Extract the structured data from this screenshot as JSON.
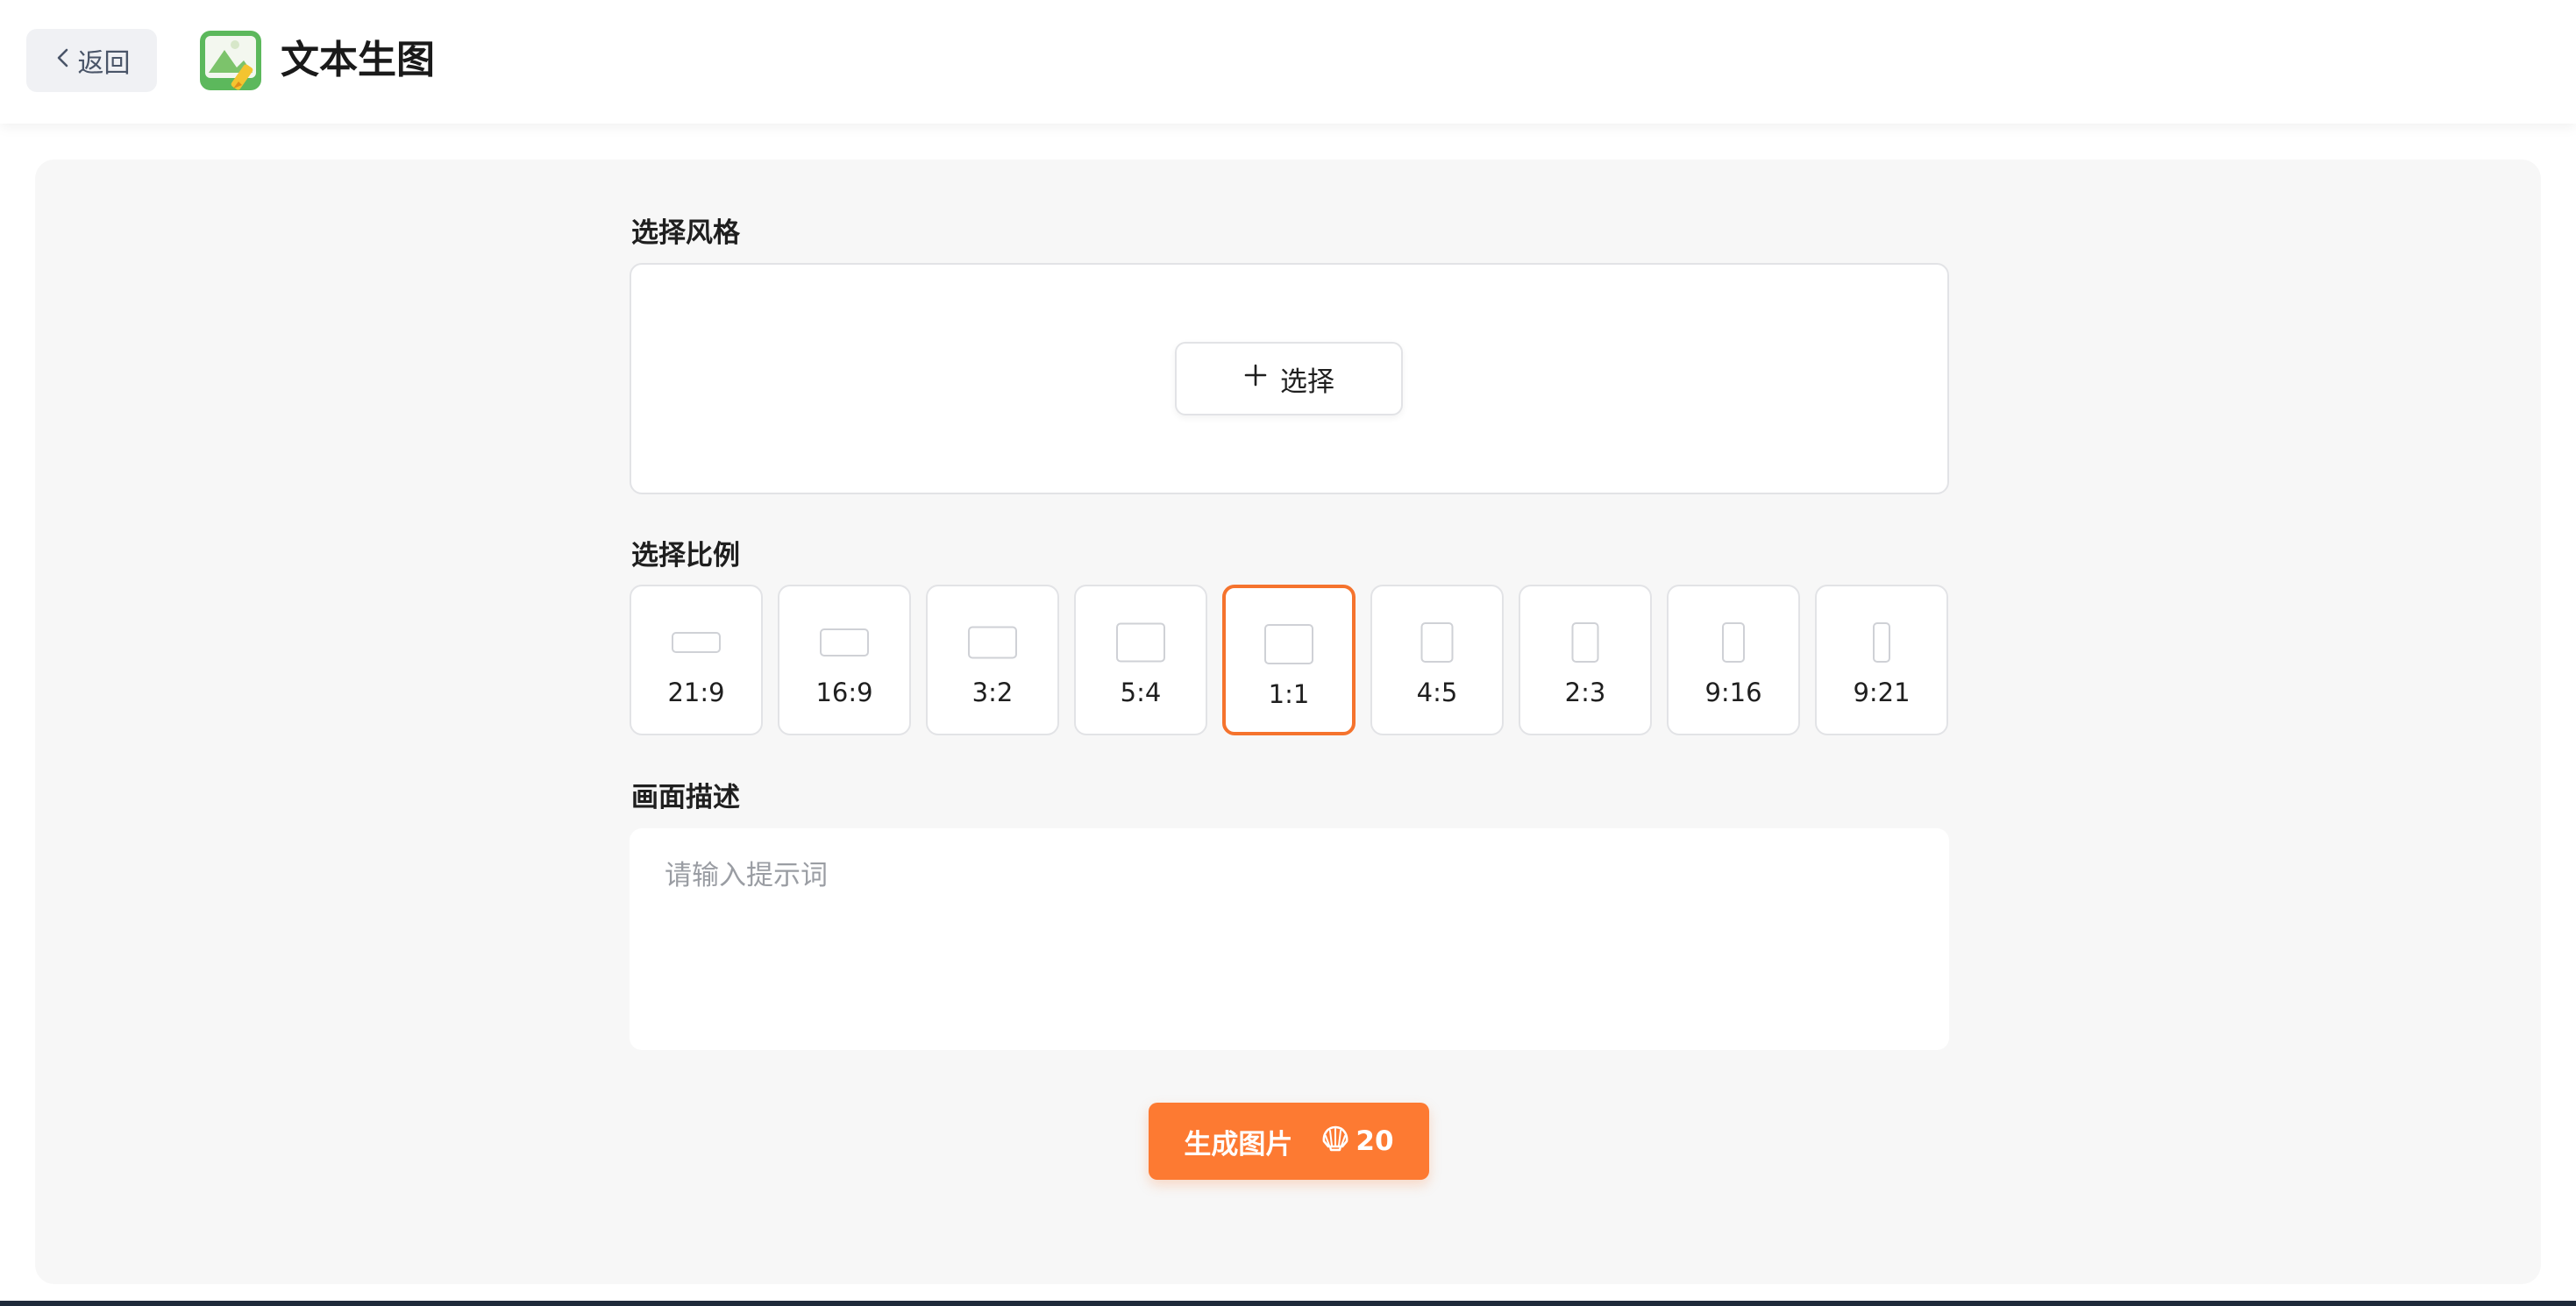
{
  "header": {
    "back_label": "返回",
    "app_title": "文本生图"
  },
  "style_section": {
    "label": "选择风格",
    "select_label": "选择"
  },
  "ratio_section": {
    "label": "选择比例",
    "options": [
      {
        "label": "21:9",
        "w": 21,
        "h": 9
      },
      {
        "label": "16:9",
        "w": 16,
        "h": 9
      },
      {
        "label": "3:2",
        "w": 3,
        "h": 2
      },
      {
        "label": "5:4",
        "w": 5,
        "h": 4
      },
      {
        "label": "1:1",
        "w": 1,
        "h": 1
      },
      {
        "label": "4:5",
        "w": 4,
        "h": 5
      },
      {
        "label": "2:3",
        "w": 2,
        "h": 3
      },
      {
        "label": "9:16",
        "w": 9,
        "h": 16
      },
      {
        "label": "9:21",
        "w": 9,
        "h": 21
      }
    ],
    "selected": "1:1"
  },
  "description_section": {
    "label": "画面描述",
    "value": "",
    "placeholder": "请输入提示词"
  },
  "generate": {
    "label": "生成图片",
    "cost": "20",
    "cost_icon": "shell-icon"
  },
  "colors": {
    "accent": "#fd7a32",
    "selected_border": "#f5732d"
  }
}
